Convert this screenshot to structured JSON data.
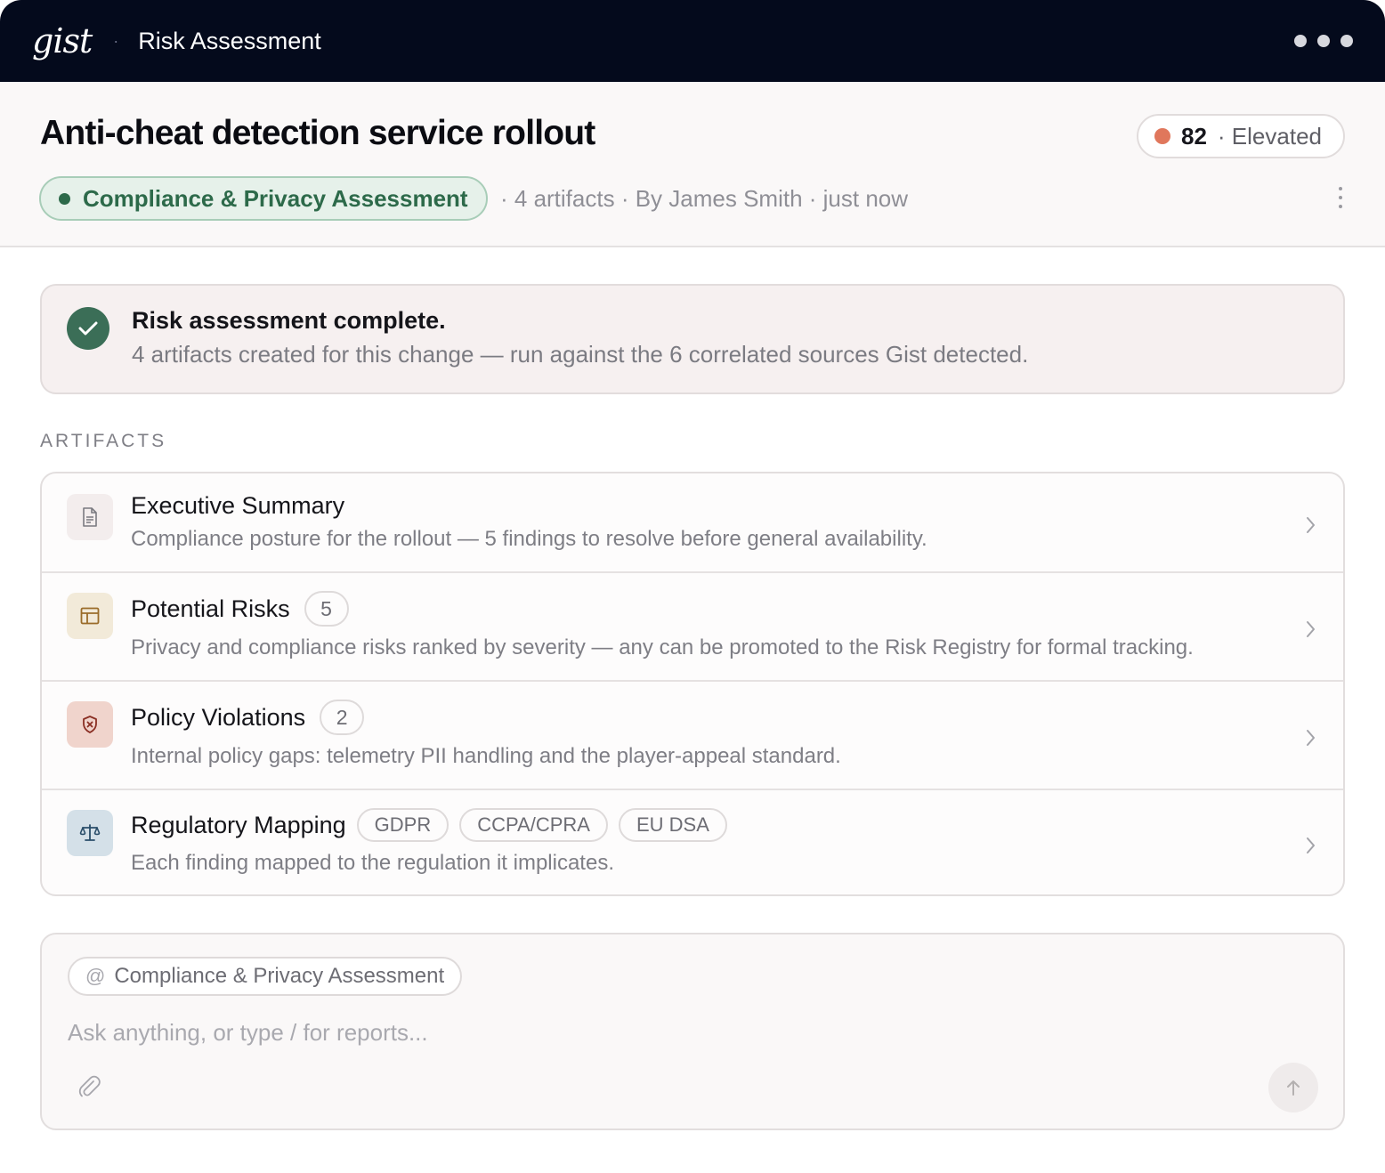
{
  "app": {
    "logo": "gist",
    "separator": "·",
    "title": "Risk Assessment"
  },
  "header": {
    "title": "Anti-cheat detection service rollout",
    "score": {
      "value": "82",
      "label": "· Elevated",
      "color": "#e0775c"
    },
    "assessment_type": "Compliance & Privacy Assessment",
    "meta": "· 4 artifacts · By James Smith · just now"
  },
  "banner": {
    "title": "Risk assessment complete.",
    "subtitle": "4 artifacts created for this change — run against the 6 correlated sources Gist detected."
  },
  "artifacts": {
    "section_label": "ARTIFACTS",
    "items": [
      {
        "title": "Executive Summary",
        "description": "Compliance posture for the rollout — 5 findings to resolve before general availability.",
        "icon": "document-icon"
      },
      {
        "title": "Potential Risks",
        "count": "5",
        "description": "Privacy and compliance risks ranked by severity — any can be promoted to the Risk Registry for formal tracking.",
        "icon": "table-icon"
      },
      {
        "title": "Policy Violations",
        "count": "2",
        "description": "Internal policy gaps: telemetry PII handling and the player-appeal standard.",
        "icon": "shield-x-icon"
      },
      {
        "title": "Regulatory Mapping",
        "tags": [
          "GDPR",
          "CCPA/CPRA",
          "EU DSA"
        ],
        "description": "Each finding mapped to the regulation it implicates.",
        "icon": "scales-icon"
      }
    ]
  },
  "composer": {
    "context_symbol": "@",
    "context": "Compliance & Privacy Assessment",
    "placeholder": "Ask anything, or type / for reports...",
    "value": ""
  },
  "colors": {
    "topbar": "#040a1c",
    "accent_green": "#2d6a4a",
    "check": "#3b6e57"
  }
}
